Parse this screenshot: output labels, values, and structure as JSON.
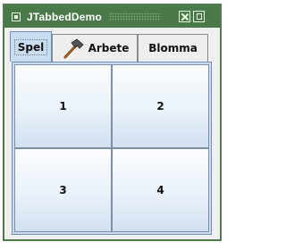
{
  "window": {
    "title": "JTabbedDemo",
    "icons": {
      "app": "app-icon",
      "close": "close-icon",
      "maximize": "maximize-icon"
    }
  },
  "tabs": [
    {
      "label": "Spel",
      "selected": true
    },
    {
      "label": "Arbete",
      "icon": "hammer-icon",
      "selected": false
    },
    {
      "label": "Blomma",
      "selected": false
    }
  ],
  "buttons": [
    "1",
    "2",
    "3",
    "4"
  ],
  "colors": {
    "titlebar": "#4a7a4a",
    "selected_tab": "#c9dcf0",
    "panel_border": "#6f8fb5"
  }
}
